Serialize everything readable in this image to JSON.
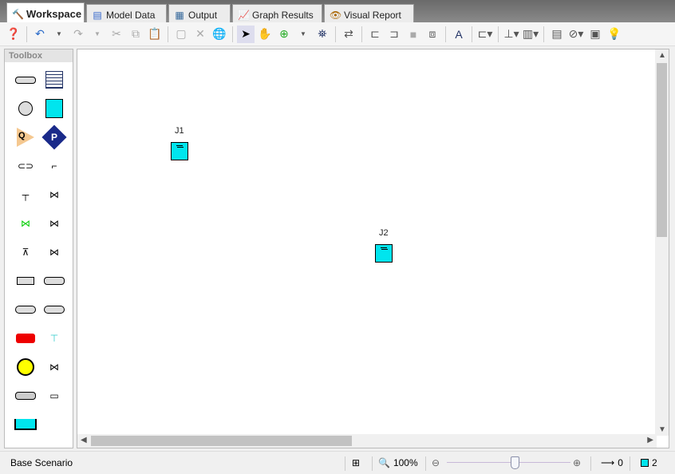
{
  "tabs": [
    {
      "label": "Workspace",
      "icon": "hammer-icon",
      "active": true
    },
    {
      "label": "Model Data",
      "icon": "model-data-icon"
    },
    {
      "label": "Output",
      "icon": "table-icon"
    },
    {
      "label": "Graph Results",
      "icon": "graph-icon"
    },
    {
      "label": "Visual Report",
      "icon": "eye-icon"
    }
  ],
  "toolbar": [
    "help",
    "undo",
    "redo",
    "cut",
    "copy",
    "paste",
    "select-all",
    "delete",
    "web",
    "arrow-select",
    "pan",
    "zoom",
    "find",
    "swap",
    "align-left",
    "align-right",
    "lock",
    "group",
    "annotation",
    "connect",
    "axis",
    "arrange",
    "properties",
    "disable",
    "notes",
    "tips"
  ],
  "toolbox": {
    "title": "Toolbox"
  },
  "workspace": {
    "junctions": [
      {
        "label": "J1"
      },
      {
        "label": "J2"
      }
    ],
    "junction_color": "#00e5ee"
  },
  "status": {
    "scenario": "Base Scenario",
    "zoom": "100%",
    "zoom_level": 0.55,
    "pipes_count": "0",
    "junctions_count": "2"
  }
}
